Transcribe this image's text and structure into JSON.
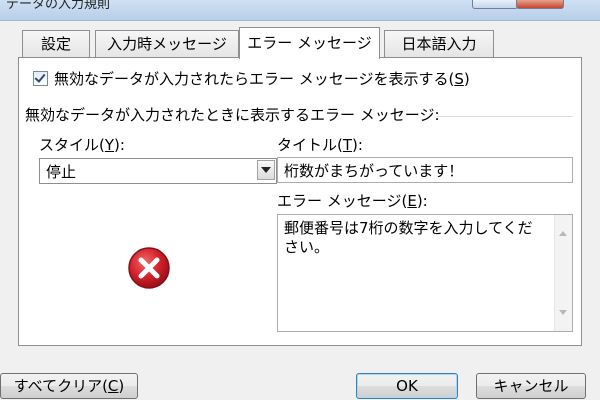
{
  "window": {
    "title": "データの入力規則"
  },
  "tabs": [
    {
      "label": "設定",
      "active": false
    },
    {
      "label": "入力時メッセージ",
      "active": false
    },
    {
      "label": "エラー メッセージ",
      "active": true
    },
    {
      "label": "日本語入力",
      "active": false
    }
  ],
  "show_error_checkbox": {
    "checked": true,
    "label": "無効なデータが入力されたらエラー メッセージを表示する(",
    "mnemonic": "S",
    "suffix": ")"
  },
  "group": {
    "label": "無効なデータが入力されたときに表示するエラー メッセージ:"
  },
  "style": {
    "label": "スタイル(",
    "mnemonic": "Y",
    "suffix": "):",
    "value": "停止"
  },
  "title_field": {
    "label": "タイトル(",
    "mnemonic": "T",
    "suffix": "):",
    "value": "桁数がまちがっています！"
  },
  "message_field": {
    "label": "エラー メッセージ(",
    "mnemonic": "E",
    "suffix": "):",
    "value": "郵便番号は7桁の数字を入力してください。"
  },
  "icons": {
    "style_icon": "error-stop-icon"
  },
  "buttons": {
    "clear_all": {
      "label": "すべてクリア(",
      "mnemonic": "C",
      "suffix": ")"
    },
    "ok": {
      "label": "OK"
    },
    "cancel": {
      "label": "キャンセル"
    }
  },
  "colors": {
    "error_red": "#d0202a",
    "focus_blue": "#3c7fb1",
    "tab_border": "#8e8f8f"
  }
}
